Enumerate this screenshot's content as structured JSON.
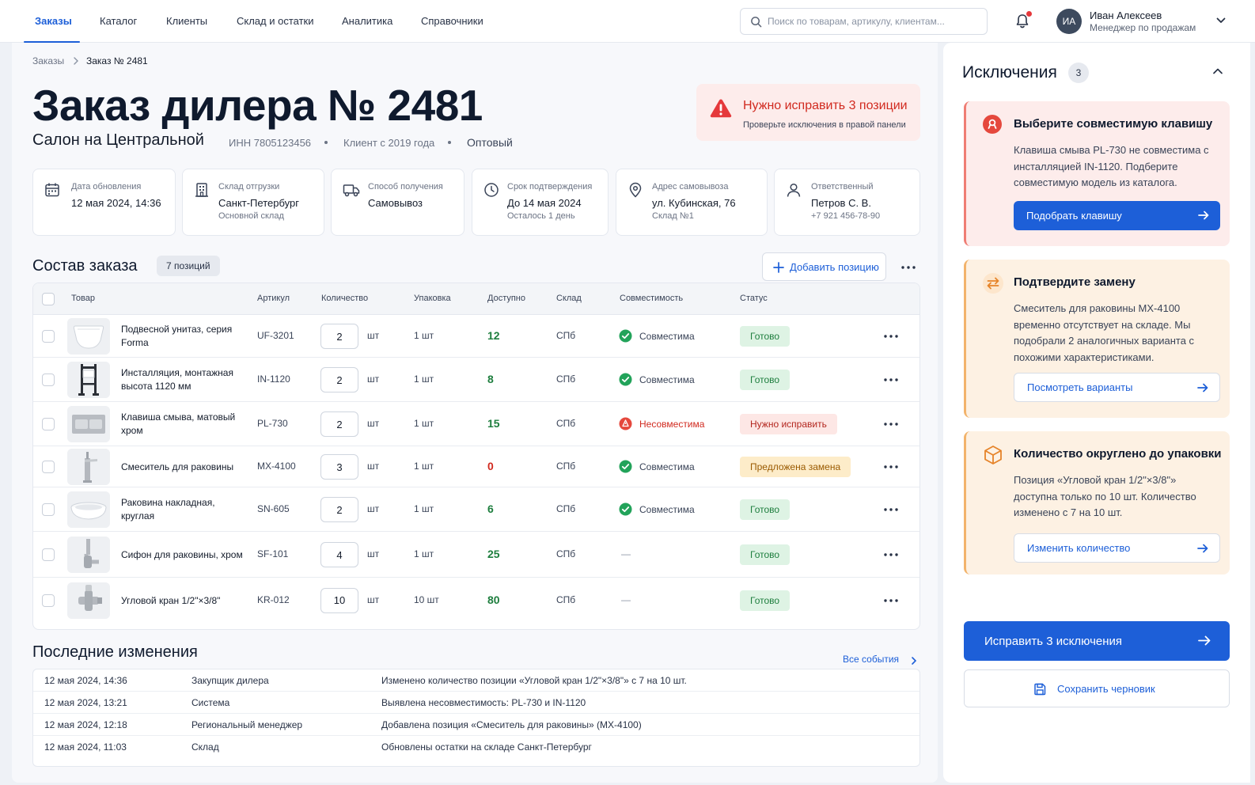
{
  "nav": {
    "tabs": [
      "Заказы",
      "Каталог",
      "Клиенты",
      "Склад и остатки",
      "Аналитика",
      "Справочники"
    ],
    "search_placeholder": "Поиск по товарам, артикулу, клиентам...",
    "user": {
      "initials": "ИА",
      "name": "Иван Алексеев",
      "role": "Менеджер по продажам"
    }
  },
  "breadcrumb": {
    "root": "Заказы",
    "current": "Заказ № 2481"
  },
  "header": {
    "title": "Заказ дилера № 2481",
    "client": "Салон на Центральной",
    "inn": "ИНН 7805123456",
    "since": "Клиент с 2019 года",
    "type": "Оптовый"
  },
  "alert": {
    "title": "Нужно исправить 3 позиции",
    "subtitle": "Проверьте исключения в правой панели"
  },
  "info": [
    {
      "label": "Дата обновления",
      "value": "12 мая 2024, 14:36",
      "sub": "",
      "icon": "calendar-icon"
    },
    {
      "label": "Склад отгрузки",
      "value": "Санкт-Петербург",
      "sub": "Основной склад",
      "icon": "building-icon"
    },
    {
      "label": "Способ получения",
      "value": "Самовывоз",
      "sub": "",
      "icon": "truck-icon"
    },
    {
      "label": "Срок подтверждения",
      "value": "До 14 мая 2024",
      "sub": "Осталось 1 день",
      "icon": "clock-icon"
    },
    {
      "label": "Адрес самовывоза",
      "value": "ул. Кубинская, 76",
      "sub": "Склад №1",
      "icon": "map-pin-icon"
    },
    {
      "label": "Ответственный",
      "value": "Петров С. В.",
      "sub": "+7 921 456-78-90",
      "icon": "user-icon"
    }
  ],
  "order": {
    "title": "Состав заказа",
    "count": "7 позиций",
    "add_label": "Добавить позицию",
    "columns": [
      "Товар",
      "Артикул",
      "Количество",
      "Упаковка",
      "Доступно",
      "Склад",
      "Совместимость",
      "Статус"
    ],
    "rows": [
      {
        "name": "Подвесной унитаз, серия Forma",
        "sku": "UF-3201",
        "qty": "2",
        "unit": "шт",
        "pack": "1 шт",
        "avail": "12",
        "avail_color": "#1e7e3e",
        "wh": "СПб",
        "compat": "Совместима",
        "compat_type": "ok",
        "status": "Готово",
        "status_type": "ok",
        "img": "toilet"
      },
      {
        "name": "Инсталляция, монтажная высота 1120 мм",
        "sku": "IN-1120",
        "qty": "2",
        "unit": "шт",
        "pack": "1 шт",
        "avail": "8",
        "avail_color": "#1e7e3e",
        "wh": "СПб",
        "compat": "Совместима",
        "compat_type": "ok",
        "status": "Готово",
        "status_type": "ok",
        "img": "frame"
      },
      {
        "name": "Клавиша смыва, матовый хром",
        "sku": "PL-730",
        "qty": "2",
        "unit": "шт",
        "pack": "1 шт",
        "avail": "15",
        "avail_color": "#1e7e3e",
        "wh": "СПб",
        "compat": "Несовместима",
        "compat_type": "err",
        "status": "Нужно исправить",
        "status_type": "err",
        "img": "plate"
      },
      {
        "name": "Смеситель для раковины",
        "sku": "MX-4100",
        "qty": "3",
        "unit": "шт",
        "pack": "1 шт",
        "avail": "0",
        "avail_color": "#d12a1f",
        "wh": "СПб",
        "compat": "Совместима",
        "compat_type": "ok",
        "status": "Предложена замена",
        "status_type": "warn",
        "img": "faucet"
      },
      {
        "name": "Раковина накладная, круглая",
        "sku": "SN-605",
        "qty": "2",
        "unit": "шт",
        "pack": "1 шт",
        "avail": "6",
        "avail_color": "#1e7e3e",
        "wh": "СПб",
        "compat": "Совместима",
        "compat_type": "ok",
        "status": "Готово",
        "status_type": "ok",
        "img": "basin"
      },
      {
        "name": "Сифон для раковины, хром",
        "sku": "SF-101",
        "qty": "4",
        "unit": "шт",
        "pack": "1 шт",
        "avail": "25",
        "avail_color": "#1e7e3e",
        "wh": "СПб",
        "compat": "—",
        "compat_type": "none",
        "status": "Готово",
        "status_type": "ok",
        "img": "siphon"
      },
      {
        "name": "Угловой кран 1/2\"×3/8\"",
        "sku": "KR-012",
        "qty": "10",
        "unit": "шт",
        "pack": "10 шт",
        "avail": "80",
        "avail_color": "#1e7e3e",
        "wh": "СПб",
        "compat": "—",
        "compat_type": "none",
        "status": "Готово",
        "status_type": "ok",
        "img": "valve"
      }
    ]
  },
  "history": {
    "title": "Последние изменения",
    "all_label": "Все события",
    "rows": [
      {
        "date": "12 мая 2024, 14:36",
        "actor": "Закупщик дилера",
        "text": "Изменено количество позиции «Угловой кран 1/2\"×3/8\"» с 7 на 10 шт."
      },
      {
        "date": "12 мая 2024, 13:21",
        "actor": "Система",
        "text": "Выявлена несовместимость: PL-730 и IN-1120"
      },
      {
        "date": "12 мая 2024, 12:18",
        "actor": "Региональный менеджер",
        "text": "Добавлена позиция «Смеситель для раковины» (MX-4100)"
      },
      {
        "date": "12 мая 2024, 11:03",
        "actor": "Склад",
        "text": "Обновлены остатки на складе Санкт-Петербург"
      }
    ]
  },
  "exceptions": {
    "title": "Исключения",
    "count": "3",
    "items": [
      {
        "title": "Выберите совместимую клавишу",
        "text": "Клавиша смыва PL-730 не совместима с инсталляцией IN-1120. Подберите совместимую модель из каталога.",
        "button": "Подобрать клавишу",
        "kind": "error",
        "icon": "error-icon"
      },
      {
        "title": "Подтвердите замену",
        "text": "Смеситель для раковины MX-4100 временно отсутствует на складе. Мы подобрали 2 аналогичных варианта с похожими характеристиками.",
        "button": "Посмотреть варианты",
        "kind": "warning",
        "icon": "swap-icon"
      },
      {
        "title": "Количество округлено до упаковки",
        "text": "Позиция «Угловой кран 1/2\"×3/8\"» доступна только по 10 шт. Количество изменено с 7 на 10 шт.",
        "button": "Изменить количество",
        "kind": "warning",
        "icon": "box-icon"
      }
    ]
  },
  "actions": {
    "fix": "Исправить 3 исключения",
    "draft": "Сохранить черновик"
  },
  "colors": {
    "accent": "#1d5fd8",
    "success": "#1e7e3e",
    "danger": "#d12a1f",
    "warning": "#f2b36b"
  }
}
